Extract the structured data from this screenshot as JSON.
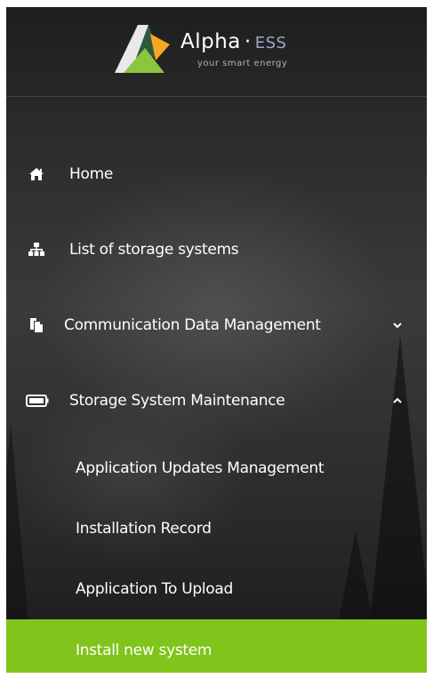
{
  "brand": {
    "name": "Alpha",
    "separator": "·",
    "suffix": "ESS",
    "tagline": "your smart energy",
    "colors": {
      "logo_green": "#8cc63f",
      "logo_orange": "#f7a823",
      "logo_dark": "#2d5a3d",
      "active_green": "#80c41c"
    }
  },
  "menu": {
    "items": [
      {
        "label": "Home",
        "icon": "home-icon",
        "expandable": false
      },
      {
        "label": "List of storage systems",
        "icon": "sitemap-icon",
        "expandable": false
      },
      {
        "label": "Communication Data Management",
        "icon": "copy-icon",
        "expandable": true,
        "expanded": false,
        "chevron": "chevron-down-icon"
      },
      {
        "label": "Storage System Maintenance",
        "icon": "battery-icon",
        "expandable": true,
        "expanded": true,
        "chevron": "chevron-up-icon"
      }
    ],
    "subitems": [
      {
        "label": "Application Updates Management",
        "active": false
      },
      {
        "label": "Installation Record",
        "active": false
      },
      {
        "label": "Application To Upload",
        "active": false
      },
      {
        "label": "Install new system",
        "active": true
      }
    ]
  }
}
